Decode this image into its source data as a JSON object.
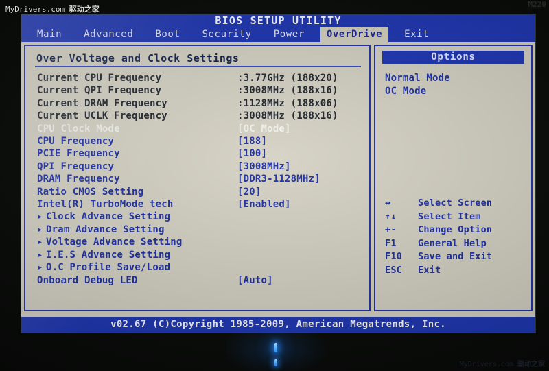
{
  "photo": {
    "watermark_top": "MyDrivers.com ",
    "watermark_top_cn": "驱动之家",
    "watermark_corner": "M220",
    "watermark_bottom": "MyDrivers.com ",
    "watermark_bottom_cn": "驱动之家"
  },
  "bios": {
    "title": "BIOS SETUP UTILITY",
    "menu": [
      {
        "label": "Main",
        "active": false
      },
      {
        "label": "Advanced",
        "active": false
      },
      {
        "label": "Boot",
        "active": false
      },
      {
        "label": "Security",
        "active": false
      },
      {
        "label": "Power",
        "active": false
      },
      {
        "label": "OverDrive",
        "active": true
      },
      {
        "label": "Exit",
        "active": false
      }
    ],
    "panel_title": "Over Voltage and Clock Settings",
    "rows": [
      {
        "kind": "info",
        "label": "Current CPU  Frequency",
        "value": ":3.77GHz  (188x20)"
      },
      {
        "kind": "info",
        "label": "Current QPI  Frequency",
        "value": ":3008MHz  (188x16)"
      },
      {
        "kind": "info",
        "label": "Current DRAM Frequency",
        "value": ":1128MHz  (188x06)"
      },
      {
        "kind": "info",
        "label": "Current UCLK Frequency",
        "value": ":3008MHz  (188x16)"
      },
      {
        "kind": "disabled",
        "label": "CPU Clock Mode",
        "value": "[OC Mode]"
      },
      {
        "kind": "setting",
        "label": "CPU  Frequency",
        "value": "[188]"
      },
      {
        "kind": "setting",
        "label": "PCIE Frequency",
        "value": "[100]"
      },
      {
        "kind": "setting",
        "label": "QPI  Frequency",
        "value": "[3008MHz]"
      },
      {
        "kind": "setting",
        "label": "DRAM Frequency",
        "value": "[DDR3-1128MHz]"
      },
      {
        "kind": "setting",
        "label": "Ratio CMOS Setting",
        "value": "[20]"
      },
      {
        "kind": "setting",
        "label": "Intel(R) TurboMode tech",
        "value": "[Enabled]"
      },
      {
        "kind": "submenu",
        "label": "Clock Advance Setting",
        "value": ""
      },
      {
        "kind": "submenu",
        "label": "Dram Advance Setting",
        "value": ""
      },
      {
        "kind": "submenu",
        "label": "Voltage Advance Setting",
        "value": ""
      },
      {
        "kind": "submenu",
        "label": "I.E.S Advance Setting",
        "value": ""
      },
      {
        "kind": "submenu",
        "label": "O.C Profile Save/Load",
        "value": ""
      },
      {
        "kind": "setting",
        "label": "Onboard Debug LED",
        "value": "[Auto]"
      }
    ],
    "options": {
      "header": "Options",
      "items": [
        {
          "label": "Normal Mode"
        },
        {
          "label": "OC Mode"
        }
      ]
    },
    "legend": [
      {
        "key": "↔",
        "desc": "Select Screen"
      },
      {
        "key": "↑↓",
        "desc": "Select Item"
      },
      {
        "key": "+-",
        "desc": "Change Option"
      },
      {
        "key": "F1",
        "desc": "General Help"
      },
      {
        "key": "F10",
        "desc": "Save and Exit"
      },
      {
        "key": "ESC",
        "desc": "Exit"
      }
    ],
    "footer": "v02.67 (C)Copyright 1985-2009, American Megatrends, Inc."
  }
}
